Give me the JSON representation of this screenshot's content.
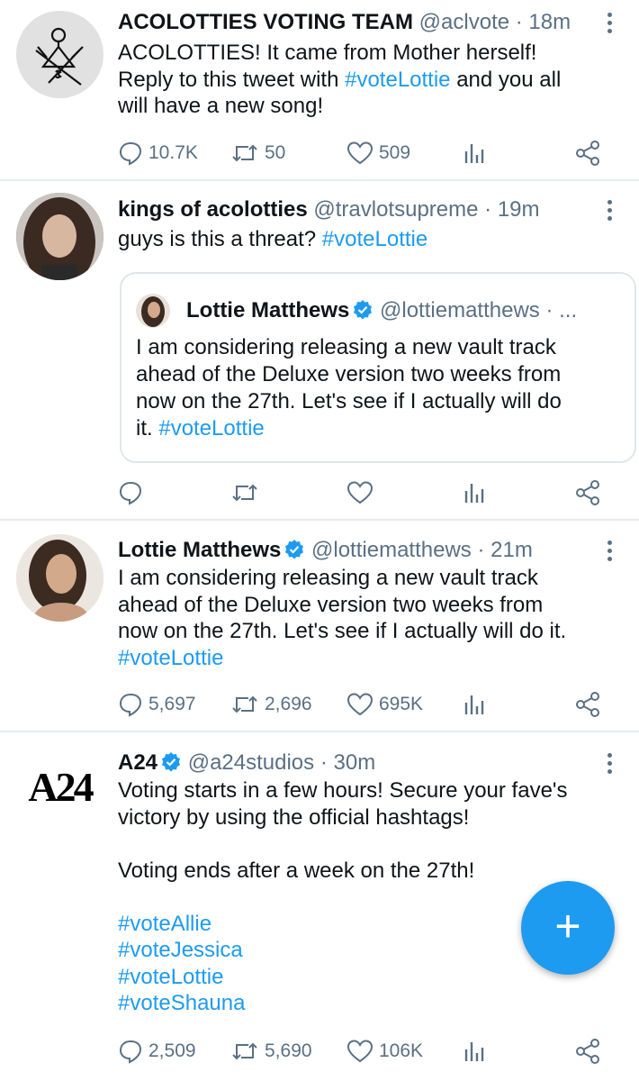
{
  "tweets": [
    {
      "name": "ACOLOTTIES VOTING TEAM",
      "handle": "@aclvote",
      "sep": "·",
      "time": "18m",
      "lines": [
        "ACOLOTTIES! It came from Mother herself!",
        "Reply to this tweet with ",
        "#voteLottie",
        " and you all",
        "will have a new song!"
      ],
      "replies": "10.7K",
      "retweets": "50",
      "likes": "509"
    },
    {
      "name": "kings of acolotties",
      "handle": "@travlotsupreme",
      "sep": "·",
      "time": "19m",
      "text": "guys is this a threat? ",
      "tag": "#voteLottie",
      "quote": {
        "name": "Lottie Matthews",
        "handle": "@lottiematthews",
        "suffix": "· ...",
        "lines": [
          "I am considering releasing a new vault track",
          "ahead of the Deluxe version two weeks from",
          "now on the 27th. Let's see if I actually will do",
          "it. "
        ],
        "tag": "#voteLottie"
      }
    },
    {
      "name": "Lottie Matthews",
      "handle": "@lottiematthews",
      "sep": "·",
      "time": "21m",
      "lines": [
        "I am considering releasing a new vault track",
        "ahead of the Deluxe version two weeks from",
        "now on the 27th. Let's see if I actually will do it."
      ],
      "tag": "#voteLottie",
      "replies": "5,697",
      "retweets": "2,696",
      "likes": "695K"
    },
    {
      "name": "A24",
      "handle": "@a24studios",
      "sep": "·",
      "time": "30m",
      "avatar_text": "A24",
      "lines": [
        "Voting starts in a few hours! Secure your fave's",
        "victory by using the official hashtags!",
        "",
        "Voting ends after a week on the 27th!",
        ""
      ],
      "tags": [
        "#voteAllie",
        "#voteJessica",
        "#voteLottie",
        "#voteShauna"
      ],
      "replies": "2,509",
      "retweets": "5,690",
      "likes": "106K"
    }
  ],
  "fab": {
    "label": "+",
    "icon": "compose-plus-icon"
  },
  "colors": {
    "accent": "#1d9bf0",
    "muted": "#5b7083",
    "text": "#0f1419"
  }
}
